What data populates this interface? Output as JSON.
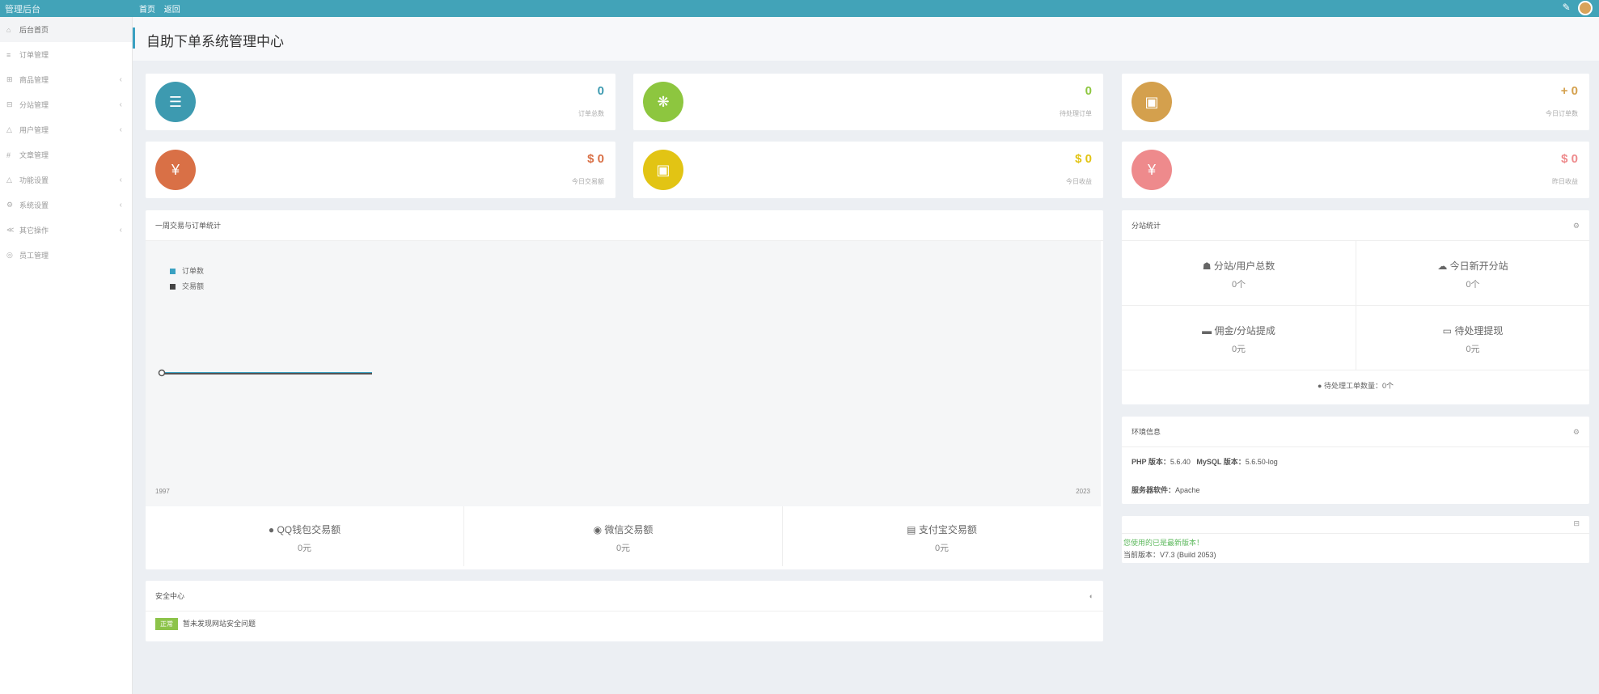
{
  "topbar": {
    "brand": "管理后台",
    "links": [
      "首页",
      "返回"
    ],
    "edit_icon": "✎"
  },
  "sidebar": {
    "items": [
      {
        "label": "后台首页",
        "icon": "home",
        "arrow": false,
        "active": true
      },
      {
        "label": "订单管理",
        "icon": "list",
        "arrow": false
      },
      {
        "label": "商品管理",
        "icon": "cart",
        "arrow": true
      },
      {
        "label": "分站管理",
        "icon": "sites",
        "arrow": true
      },
      {
        "label": "用户管理",
        "icon": "users",
        "arrow": true
      },
      {
        "label": "文章管理",
        "icon": "doc",
        "arrow": false
      },
      {
        "label": "功能设置",
        "icon": "gear",
        "arrow": true
      },
      {
        "label": "系统设置",
        "icon": "cog",
        "arrow": true
      },
      {
        "label": "其它操作",
        "icon": "more",
        "arrow": true
      },
      {
        "label": "员工管理",
        "icon": "staff",
        "arrow": false
      }
    ]
  },
  "page": {
    "title": "自助下单系统管理中心"
  },
  "stats": [
    {
      "value": "0",
      "label": "订单总数",
      "color": "#3d9ab0",
      "icon": "☰"
    },
    {
      "value": "0",
      "label": "待处理订单",
      "color": "#8dc63f",
      "icon": "❋"
    },
    {
      "value": "+ 0",
      "label": "今日订单数",
      "color": "#d4a04d",
      "icon": "▣"
    },
    {
      "value": "$ 0",
      "label": "今日交易额",
      "color": "#d97046",
      "icon": "¥"
    },
    {
      "value": "$ 0",
      "label": "今日收益",
      "color": "#e2c414",
      "icon": "▣"
    },
    {
      "value": "$ 0",
      "label": "昨日收益",
      "color": "#ee8a8c",
      "icon": "¥"
    }
  ],
  "chart_panel": {
    "title": "一周交易与订单统计",
    "legend": [
      "订单数",
      "交易额"
    ]
  },
  "chart_data": {
    "type": "line",
    "title": "一周交易与订单统计",
    "xlabel": "",
    "ylabel": "",
    "x_start_label": "1997",
    "x_end_label": "2023",
    "series": [
      {
        "name": "订单数",
        "color": "#3aa1c2",
        "values": [
          0,
          0
        ]
      },
      {
        "name": "交易额",
        "color": "#555555",
        "values": [
          0,
          0
        ]
      }
    ]
  },
  "pay_stats": [
    {
      "label": "QQ钱包交易额",
      "value": "0元",
      "icon": "●"
    },
    {
      "label": "微信交易额",
      "value": "0元",
      "icon": "◉"
    },
    {
      "label": "支付宝交易额",
      "value": "0元",
      "icon": "▤"
    }
  ],
  "security_panel": {
    "title": "安全中心",
    "badge": "正常",
    "text": "暂未发现网站安全问题"
  },
  "site_stats_panel": {
    "title": "分站统计",
    "cells": [
      {
        "label": "分站/用户总数",
        "value": "0个",
        "icon": "☗"
      },
      {
        "label": "今日新开分站",
        "value": "0个",
        "icon": "☁"
      },
      {
        "label": "佣金/分站提成",
        "value": "0元",
        "icon": "▬"
      },
      {
        "label": "待处理提现",
        "value": "0元",
        "icon": "▭"
      }
    ],
    "footer": "待处理工单数量：0个"
  },
  "env_panel": {
    "title": "环境信息",
    "php_label": "PHP 版本：",
    "php_value": "5.6.40",
    "mysql_label": "MySQL 版本：",
    "mysql_value": "5.6.50-log",
    "server_label": "服务器软件：",
    "server_value": "Apache"
  },
  "version_panel": {
    "update_text": "您使用的已是最新版本！",
    "current_text": "当前版本：V7.3 (Build 2053)"
  }
}
